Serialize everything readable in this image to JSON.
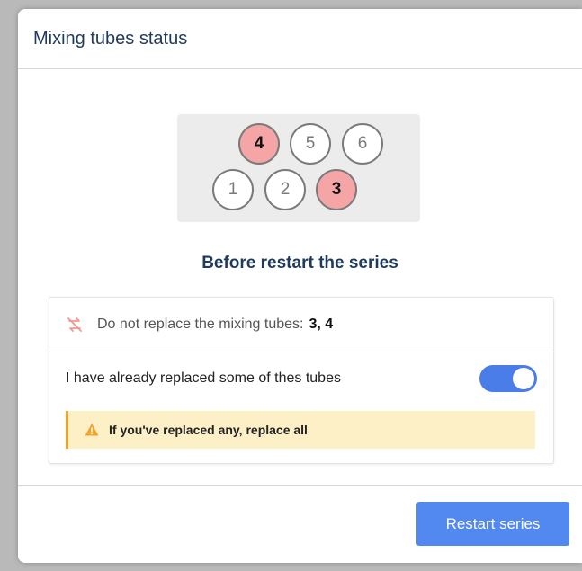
{
  "dialog": {
    "title": "Mixing tubes status"
  },
  "tubes": [
    {
      "label": "4",
      "flagged": true
    },
    {
      "label": "5",
      "flagged": false
    },
    {
      "label": "6",
      "flagged": false
    },
    {
      "label": "1",
      "flagged": false
    },
    {
      "label": "2",
      "flagged": false
    },
    {
      "label": "3",
      "flagged": true
    }
  ],
  "section": {
    "heading": "Before restart the series"
  },
  "notice": {
    "text": "Do not replace the mixing tubes:",
    "tubes": "3, 4",
    "icon": "swap-off-icon"
  },
  "replaced_toggle": {
    "label": "I have already replaced some of thes tubes",
    "on": true
  },
  "warning": {
    "text": "If you've replaced any, replace all",
    "icon": "alert-triangle-icon"
  },
  "footer": {
    "restart_label": "Restart series"
  },
  "colors": {
    "flagged_tube": "#f6a5a7",
    "accent": "#5289f0",
    "warning_bg": "#fdf0c7",
    "warning_border": "#f2a227",
    "title": "#1f3a5a"
  }
}
